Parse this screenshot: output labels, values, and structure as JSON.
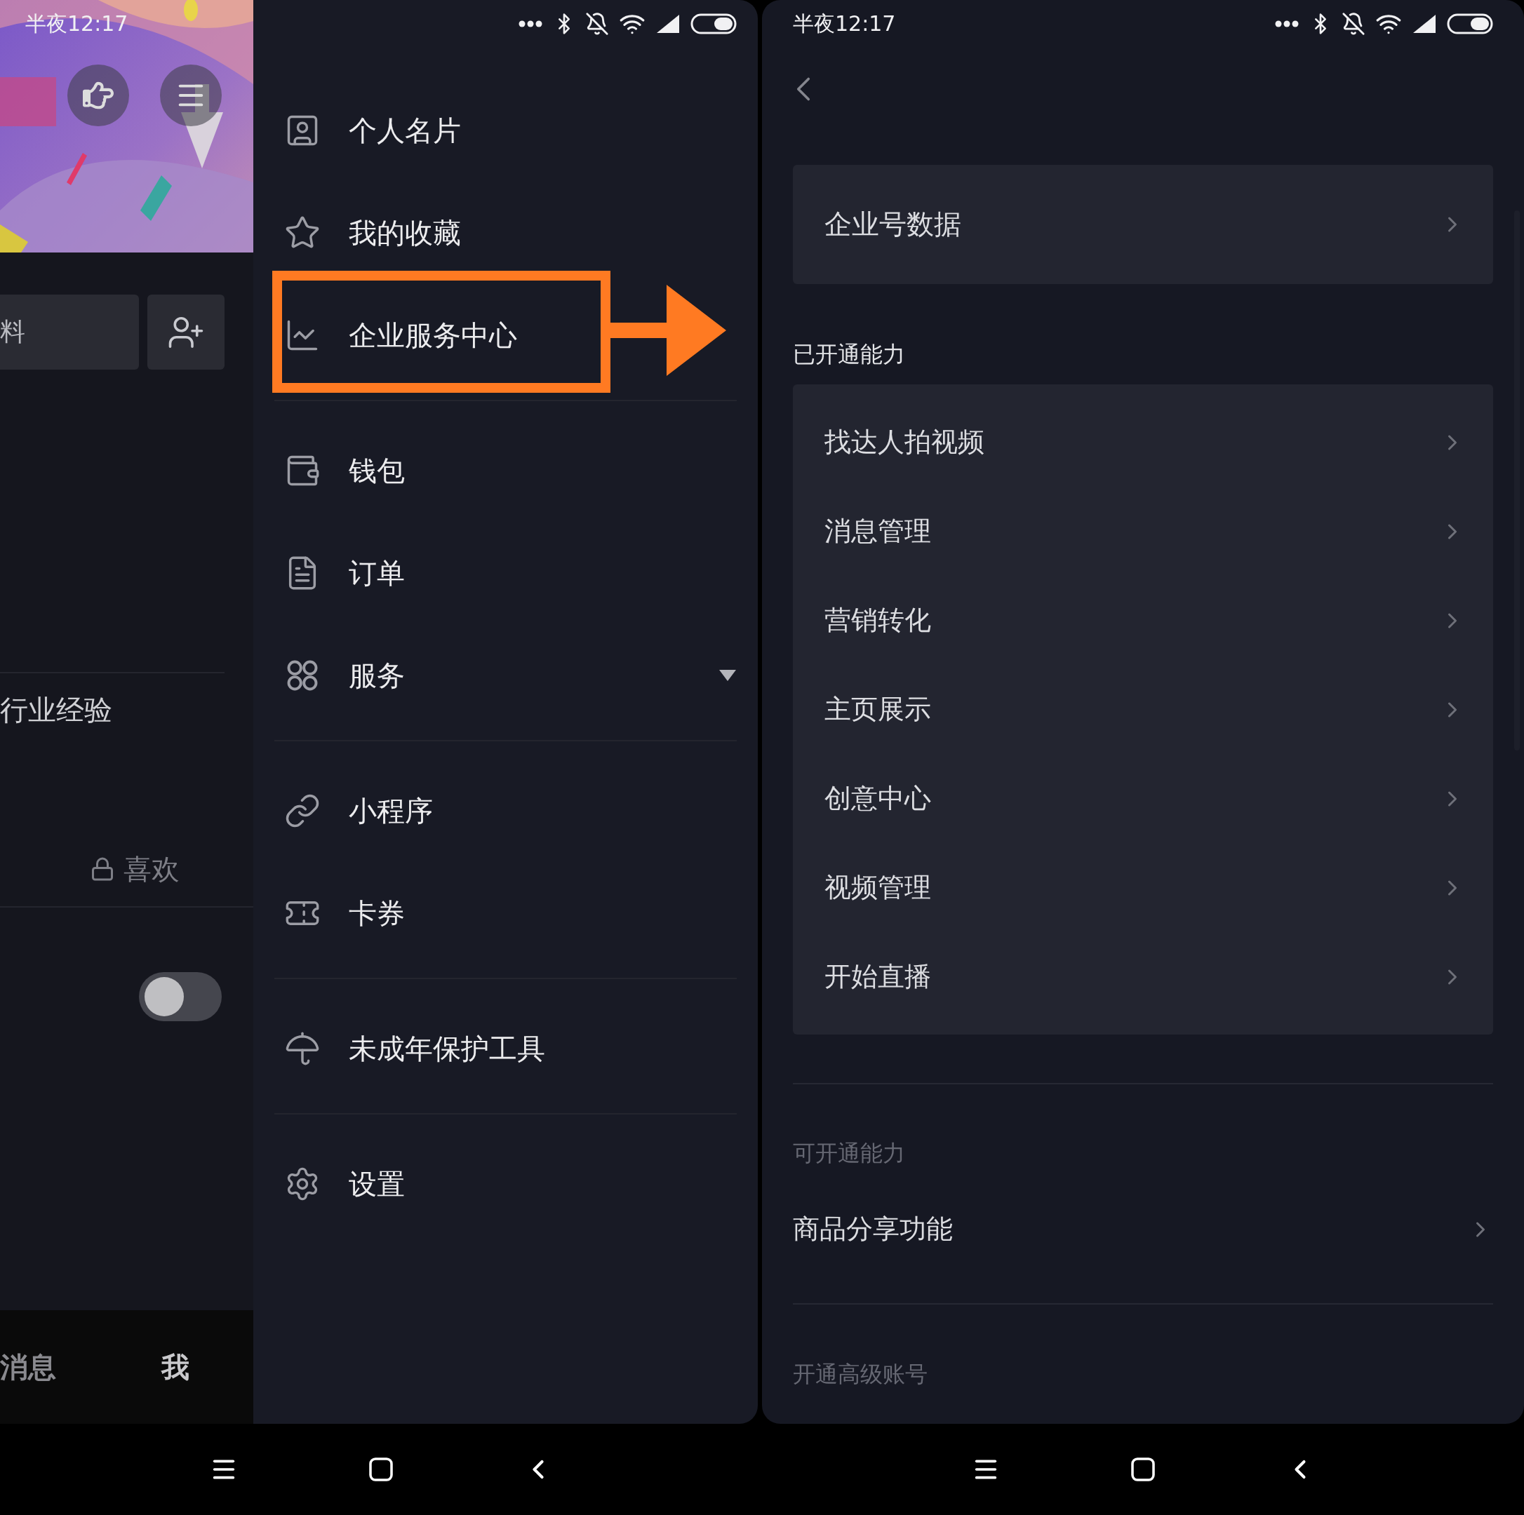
{
  "left_screen": {
    "status_time": "半夜12:17",
    "profile": {
      "field_text": "料",
      "experience_label": "行业经验",
      "likes_tab": "喜欢",
      "toggle": {
        "on": false
      },
      "tab_bar": [
        {
          "label": "消息",
          "selected": false
        },
        {
          "label": "我",
          "selected": true
        }
      ]
    },
    "drawer": {
      "groups": [
        {
          "items": [
            {
              "label": "个人名片",
              "kind": "link",
              "highlighted": false
            },
            {
              "label": "我的收藏",
              "kind": "link",
              "highlighted": false
            },
            {
              "label": "企业服务中心",
              "kind": "link",
              "highlighted": true
            }
          ]
        },
        {
          "items": [
            {
              "label": "钱包",
              "kind": "link",
              "highlighted": false
            },
            {
              "label": "订单",
              "kind": "link",
              "highlighted": false
            },
            {
              "label": "服务",
              "kind": "dropdown",
              "highlighted": false
            }
          ]
        },
        {
          "items": [
            {
              "label": "小程序",
              "kind": "link",
              "highlighted": false
            },
            {
              "label": "卡券",
              "kind": "link",
              "highlighted": false
            }
          ]
        },
        {
          "items": [
            {
              "label": "未成年保护工具",
              "kind": "link",
              "highlighted": false
            }
          ]
        },
        {
          "items": [
            {
              "label": "设置",
              "kind": "link",
              "highlighted": false
            }
          ]
        }
      ]
    }
  },
  "right_screen": {
    "status_time": "半夜12:17",
    "top_card": [
      {
        "label": "企业号数据"
      }
    ],
    "enabled_section": {
      "title": "已开通能力",
      "items": [
        {
          "label": "找达人拍视频"
        },
        {
          "label": "消息管理"
        },
        {
          "label": "营销转化"
        },
        {
          "label": "主页展示"
        },
        {
          "label": "创意中心"
        },
        {
          "label": "视频管理"
        },
        {
          "label": "开始直播"
        }
      ]
    },
    "available_section": {
      "title": "可开通能力",
      "items": [
        {
          "label": "商品分享功能"
        }
      ]
    },
    "upgrade_section": {
      "title": "开通高级账号"
    }
  }
}
